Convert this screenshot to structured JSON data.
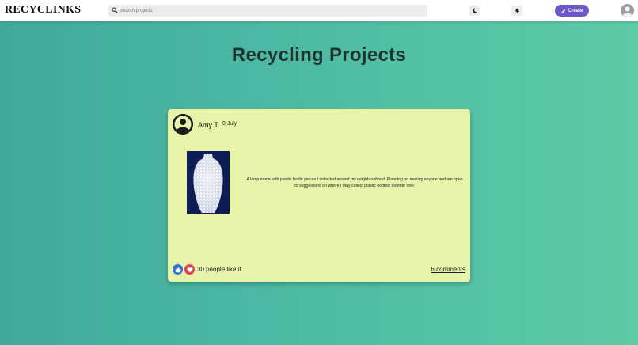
{
  "header": {
    "logo": "RECYCLINKS",
    "search_placeholder": "Search projects",
    "create_label": "Create",
    "icons": {
      "search": "search-icon",
      "theme": "moon-icon",
      "notifications": "bell-icon",
      "create": "pencil-icon",
      "profile": "user-avatar-icon"
    }
  },
  "page": {
    "title": "Recycling Projects"
  },
  "post": {
    "author": "Amy T.",
    "date": "9 July",
    "text": "A lamp made with plastic bottle pieces I collected around my neighbourhood! Planning on making anyone and am open to suggestions on where I may collect plastic bottles! another one!",
    "likes_text": "30 people like it",
    "comments_text": "6 comments"
  },
  "colors": {
    "accent": "#6e57c9",
    "card_background": "#e6f3a8",
    "like": "#2f72d6",
    "love": "#e0404f"
  }
}
